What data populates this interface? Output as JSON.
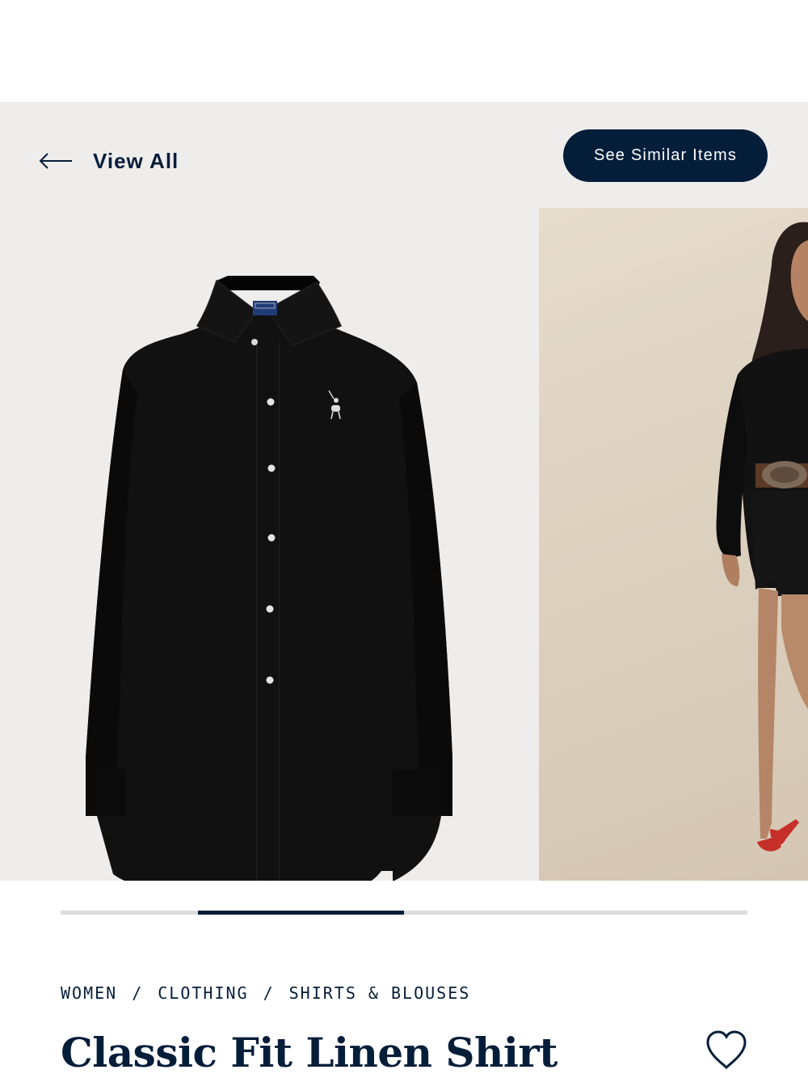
{
  "nav": {
    "back_label": "View All",
    "back_icon": "arrow-left-icon",
    "similar_label": "See Similar Items"
  },
  "gallery": {
    "slides": [
      {
        "kind": "product-flat",
        "description_icon": "black-linen-shirt"
      },
      {
        "kind": "model-photo",
        "description_icon": "model-wearing-shirt"
      }
    ],
    "progress": {
      "segments": 4,
      "active_index": 1
    }
  },
  "breadcrumb": [
    "WOMEN",
    "CLOTHING",
    "SHIRTS & BLOUSES"
  ],
  "breadcrumb_separator": "/",
  "product": {
    "title": "Classic Fit Linen Shirt",
    "wishlist_icon": "heart-icon"
  },
  "colors": {
    "navy": "#041e3a",
    "gallery_bg": "#efedec",
    "shirt": "#0d0d0d"
  }
}
